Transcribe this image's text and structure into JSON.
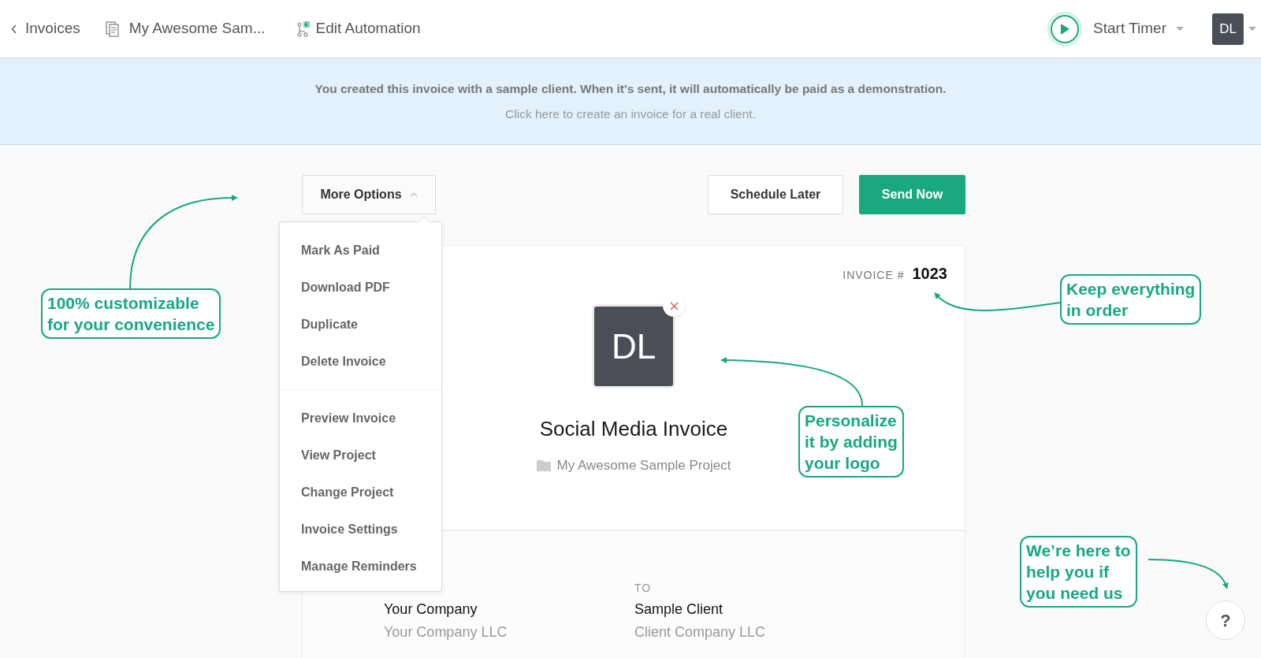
{
  "top_bar": {
    "back_link": "Invoices",
    "project_link": "My Awesome Sam...",
    "automation_link": "Edit Automation",
    "timer": "Start Timer",
    "avatar": "DL"
  },
  "banner": {
    "message": "You created this invoice with a sample client. When it's sent, it will automatically be paid as a demonstration.",
    "link": "Click here to create an invoice for a real client."
  },
  "actions": {
    "more_options": {
      "label": "More Options",
      "expanded": true
    },
    "schedule": "Schedule Later",
    "send": "Send Now"
  },
  "menu": {
    "groups": [
      {
        "items": [
          "Mark As Paid",
          "Download PDF",
          "Duplicate",
          "Delete Invoice"
        ]
      },
      {
        "items": [
          "Preview Invoice",
          "View Project",
          "Change Project",
          "Invoice Settings",
          "Manage Reminders"
        ]
      }
    ]
  },
  "invoice": {
    "number_label": "INVOICE #",
    "number": "1023",
    "logo": "DL",
    "title": "Social Media Invoice",
    "project": "My Awesome Sample Project",
    "from": {
      "name": "Your Company",
      "company": "Your Company LLC"
    },
    "to": {
      "label": "TO",
      "name": "Sample Client",
      "company": "Client Company LLC"
    }
  },
  "callouts": [
    {
      "lines": [
        "100% customizable",
        "for your convenience"
      ]
    },
    {
      "lines": [
        "Keep everything",
        "in order"
      ]
    },
    {
      "lines": [
        "Personalize",
        "it by adding",
        "your logo"
      ]
    },
    {
      "lines": [
        "We’re here to",
        "help you if",
        "you need us"
      ]
    }
  ],
  "help": "?"
}
